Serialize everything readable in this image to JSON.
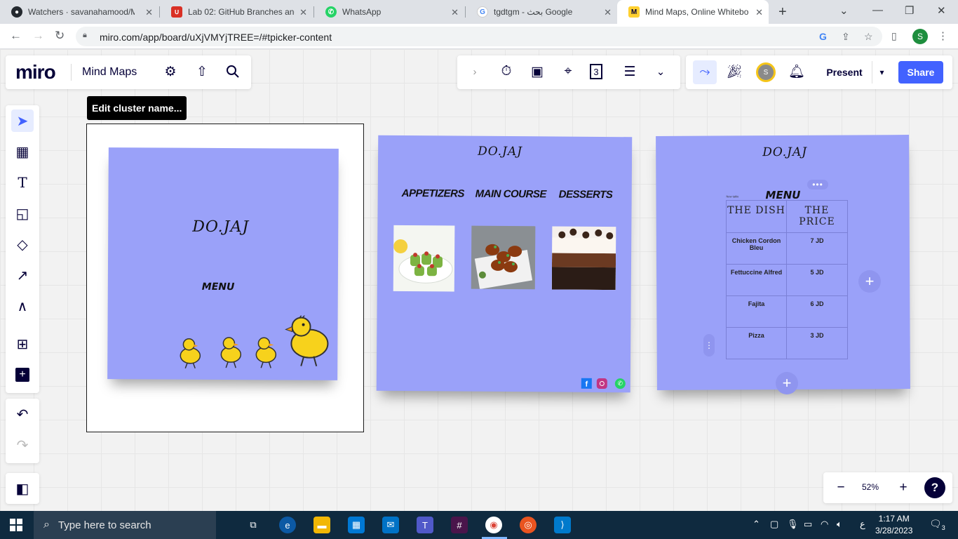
{
  "browser": {
    "tabs": [
      {
        "title": "Watchers · savanahamood/M",
        "icon": "github-icon",
        "color": "#24292f",
        "active": false
      },
      {
        "title": "Lab 02: GitHub Branches and",
        "icon": "course-icon",
        "color": "#d93025",
        "active": false
      },
      {
        "title": "WhatsApp",
        "icon": "whatsapp-icon",
        "color": "#25d366",
        "active": false
      },
      {
        "title": "tgdtgm - بحث Google",
        "icon": "google-icon",
        "color": "#4285f4",
        "active": false
      },
      {
        "title": "Mind Maps, Online Whitebo",
        "icon": "miro-icon",
        "color": "#ffd02f",
        "active": true
      }
    ],
    "url": "miro.com/app/board/uXjVMYjTREE=/#tpicker-content",
    "profile_initial": "S"
  },
  "miro": {
    "logo": "miro",
    "board_title": "Mind Maps",
    "present_label": "Present",
    "share_label": "Share",
    "avatar_initial": "S",
    "tooltip": "Edit cluster name...",
    "zoom": "52%",
    "help": "?",
    "accent": "#4262ff",
    "card_color": "#9aa1f9"
  },
  "board": {
    "card1": {
      "brand": "DO.JAJ",
      "menu": "MENU"
    },
    "card2": {
      "brand": "DO.JAJ",
      "categories": [
        "APPETIZERS",
        "MAIN COURSE",
        "DESSERTS"
      ]
    },
    "card3": {
      "brand": "DO.JAJ",
      "menu": "MENU",
      "small_note": "New table",
      "table": {
        "headers": [
          "THE DISH",
          "THE PRICE"
        ],
        "rows": [
          {
            "dish": "Chicken Cordon Bleu",
            "price": "7 JD"
          },
          {
            "dish": "Fettuccine Alfred",
            "price": "5 JD"
          },
          {
            "dish": "Fajita",
            "price": "6 JD"
          },
          {
            "dish": "Pizza",
            "price": "3 JD"
          }
        ]
      }
    }
  },
  "taskbar": {
    "search_placeholder": "Type here to search",
    "time": "1:17 AM",
    "date": "3/28/2023",
    "lang": "ع",
    "notifications": "3"
  }
}
